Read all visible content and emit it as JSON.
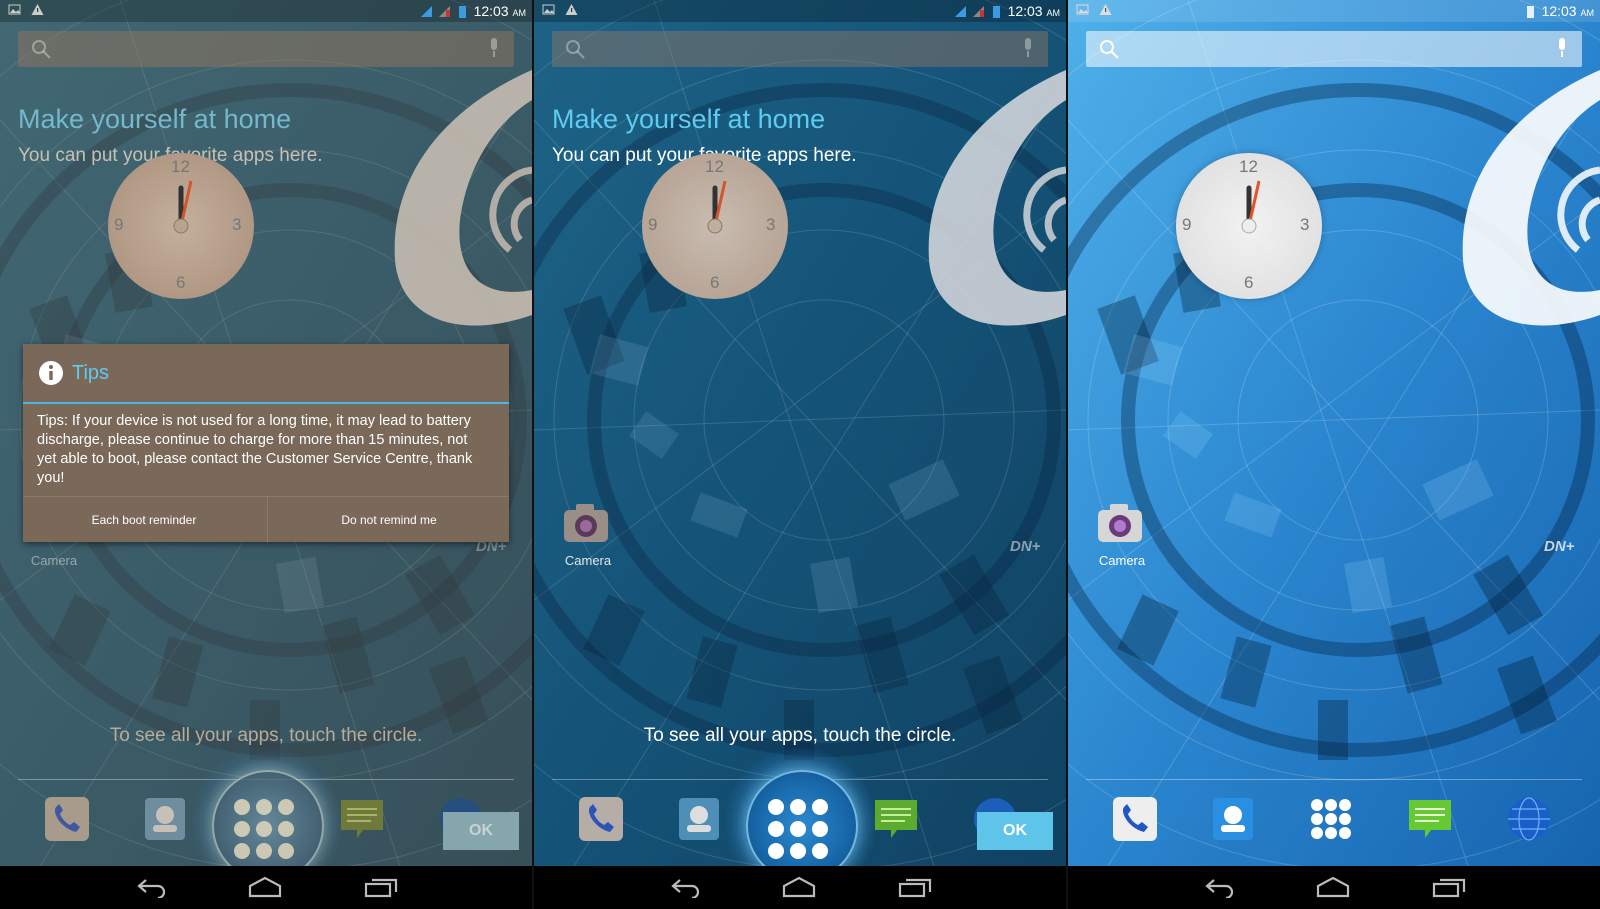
{
  "colors": {
    "accent": "#5ecbf0",
    "wallpaper_dark": "#0f5f86",
    "wallpaper_light": "#2f8fd8",
    "dialog_bg": "#7a6858",
    "ok_button": "#5ec4ea",
    "navbar": "#000000"
  },
  "status_bar": {
    "time": "12:03",
    "ampm": "AM",
    "left_icons": [
      "picture-notification-icon",
      "warning-icon"
    ],
    "right_icons": [
      "wifi-signal-icon",
      "cell-signal-icon",
      "battery-icon"
    ]
  },
  "search": {
    "icons": [
      "search-icon",
      "mic-icon"
    ]
  },
  "cling": {
    "title": "Make yourself at home",
    "subtitle": "You can put your favorite apps here.",
    "apps_hint": "To see all your apps, touch the circle.",
    "ok": "OK"
  },
  "clock_widget": {
    "n12": "12",
    "n3": "3",
    "n6": "6",
    "n9": "9"
  },
  "desktop": {
    "camera_label": "Camera",
    "logo_text": "DN+"
  },
  "dock": {
    "icons": [
      "phone-icon",
      "contacts-icon",
      "all-apps-icon",
      "messaging-icon",
      "browser-globe-icon"
    ]
  },
  "tips_dialog": {
    "title": "Tips",
    "message": "Tips: If your device is not used for a long time, it may lead to battery discharge, please continue to charge for more than 15 minutes, not yet able to boot, please contact the Customer Service Centre, thank you!",
    "button_each_boot": "Each boot reminder",
    "button_do_not_remind": "Do not remind me"
  },
  "navbar": {
    "icons": [
      "back-icon",
      "home-icon",
      "recent-apps-icon"
    ]
  }
}
